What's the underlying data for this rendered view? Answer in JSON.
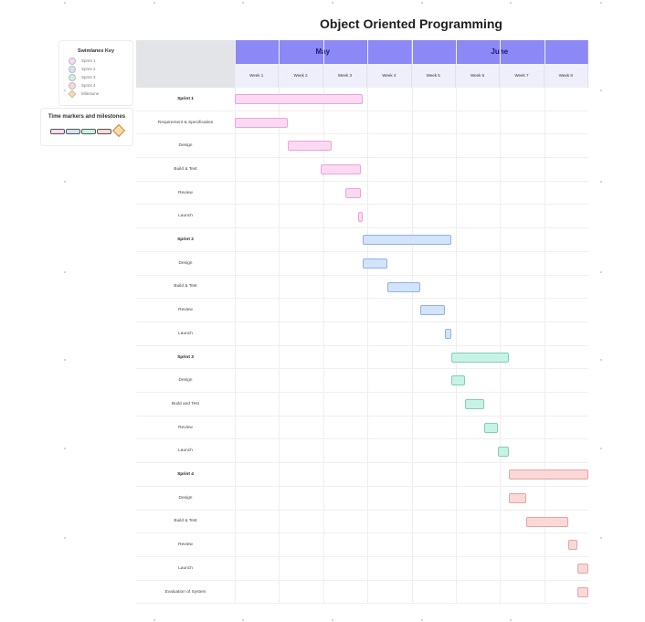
{
  "title": "Object Oriented Programming",
  "key": {
    "title": "Swimlanes Key",
    "items": [
      {
        "label": "Sprint 1",
        "color": "#fcd9f3"
      },
      {
        "label": "Sprint 2",
        "color": "#d3e3fa"
      },
      {
        "label": "Sprint 3",
        "color": "#c9f2e6"
      },
      {
        "label": "Sprint 4",
        "color": "#fbd8d8"
      },
      {
        "label": "Milestone",
        "color": "#fbd8a8"
      }
    ]
  },
  "milestones": {
    "title": "Time markers and milestones",
    "bar_colors": [
      "#fcd9f3",
      "#d3e3fa",
      "#c9f2e6",
      "#fbd8d8"
    ],
    "diamond_color": "#fbd8a8"
  },
  "timeline": {
    "months": [
      {
        "label": "May",
        "weeks": 4
      },
      {
        "label": "June",
        "weeks": 4
      }
    ],
    "weeks": [
      "Week 1",
      "Week 2",
      "Week 3",
      "Week 4",
      "Week 5",
      "Week 6",
      "Week 7",
      "Week 8"
    ]
  },
  "colors": {
    "sprint1": {
      "fill": "#fcd9f3",
      "stroke": "#e9a6d9"
    },
    "sprint2": {
      "fill": "#d3e3fa",
      "stroke": "#8fb2e6"
    },
    "sprint3": {
      "fill": "#c9f2e6",
      "stroke": "#7fcfb6"
    },
    "sprint4": {
      "fill": "#fbd8d8",
      "stroke": "#e4a4a4"
    }
  },
  "tasks": [
    {
      "label": "Sprint 1",
      "bold": true,
      "group": "sprint1",
      "start_week": 0.0,
      "end_week": 2.9
    },
    {
      "label": "Requirement & Specification",
      "bold": false,
      "group": "sprint1",
      "start_week": 0.0,
      "end_week": 1.2
    },
    {
      "label": "Design",
      "bold": false,
      "group": "sprint1",
      "start_week": 1.2,
      "end_week": 2.2
    },
    {
      "label": "Build & Test",
      "bold": false,
      "group": "sprint1",
      "start_week": 1.95,
      "end_week": 2.85
    },
    {
      "label": "Review",
      "bold": false,
      "group": "sprint1",
      "start_week": 2.5,
      "end_week": 2.85
    },
    {
      "label": "Launch",
      "bold": false,
      "group": "sprint1",
      "start_week": 2.8,
      "end_week": 2.9
    },
    {
      "label": "Sprint 2",
      "bold": true,
      "group": "sprint2",
      "start_week": 2.9,
      "end_week": 4.9
    },
    {
      "label": "Design",
      "bold": false,
      "group": "sprint2",
      "start_week": 2.9,
      "end_week": 3.45
    },
    {
      "label": "Build & Test",
      "bold": false,
      "group": "sprint2",
      "start_week": 3.45,
      "end_week": 4.2
    },
    {
      "label": "Review",
      "bold": false,
      "group": "sprint2",
      "start_week": 4.2,
      "end_week": 4.75
    },
    {
      "label": "Launch",
      "bold": false,
      "group": "sprint2",
      "start_week": 4.75,
      "end_week": 4.9
    },
    {
      "label": "Sprint 3",
      "bold": true,
      "group": "sprint3",
      "start_week": 4.9,
      "end_week": 6.2
    },
    {
      "label": "Design",
      "bold": false,
      "group": "sprint3",
      "start_week": 4.9,
      "end_week": 5.2
    },
    {
      "label": "Build and Test",
      "bold": false,
      "group": "sprint3",
      "start_week": 5.2,
      "end_week": 5.65
    },
    {
      "label": "Review",
      "bold": false,
      "group": "sprint3",
      "start_week": 5.65,
      "end_week": 5.95
    },
    {
      "label": "Launch",
      "bold": false,
      "group": "sprint3",
      "start_week": 5.95,
      "end_week": 6.2
    },
    {
      "label": "Sprint 4",
      "bold": true,
      "group": "sprint4",
      "start_week": 6.2,
      "end_week": 8.0
    },
    {
      "label": "Design",
      "bold": false,
      "group": "sprint4",
      "start_week": 6.2,
      "end_week": 6.6
    },
    {
      "label": "Build & Test",
      "bold": false,
      "group": "sprint4",
      "start_week": 6.6,
      "end_week": 7.55
    },
    {
      "label": "Review",
      "bold": false,
      "group": "sprint4",
      "start_week": 7.55,
      "end_week": 7.75
    },
    {
      "label": "Launch",
      "bold": false,
      "group": "sprint4",
      "start_week": 7.75,
      "end_week": 8.0
    },
    {
      "label": "Evaluation of System",
      "bold": false,
      "group": "sprint4",
      "start_week": 7.75,
      "end_week": 8.0
    }
  ]
}
